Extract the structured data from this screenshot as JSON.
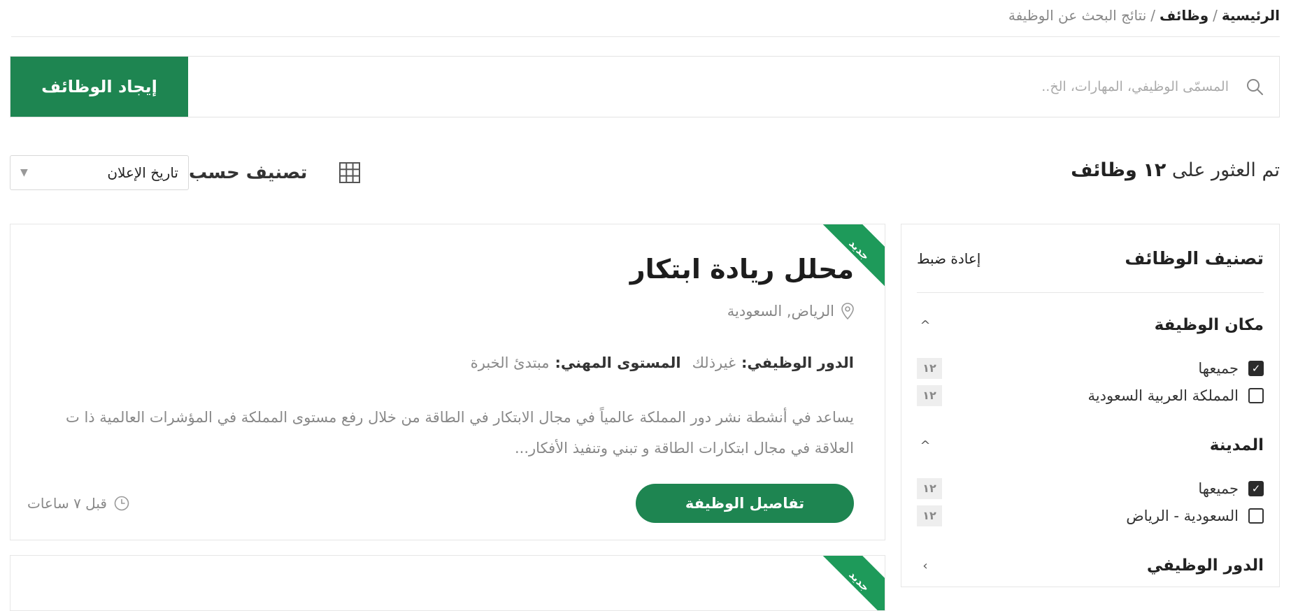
{
  "breadcrumb": {
    "home": "الرئيسية",
    "jobs": "وظائف",
    "current": "نتائج البحث عن الوظيفة",
    "separator": "/"
  },
  "search": {
    "placeholder": "المسمّى الوظيفي، المهارات، الخ..",
    "value": "",
    "button_label": "إيجاد الوظائف"
  },
  "results": {
    "prefix": "تم العثور على",
    "count": "١٢",
    "suffix": "وظائف"
  },
  "sort": {
    "label": "تصنيف حسب",
    "selected": "تاريخ الإعلان"
  },
  "filters": {
    "title": "تصنيف الوظائف",
    "reset_label": "إعادة ضبط",
    "groups": [
      {
        "title": "مكان الوظيفة",
        "options": [
          {
            "label": "جميعها",
            "count": "١٢",
            "checked": true
          },
          {
            "label": "المملكة العربية السعودية",
            "count": "١٢",
            "checked": false
          }
        ]
      },
      {
        "title": "المدينة",
        "options": [
          {
            "label": "جميعها",
            "count": "١٢",
            "checked": true
          },
          {
            "label": "السعودية - الرياض",
            "count": "١٢",
            "checked": false
          }
        ]
      },
      {
        "title": "الدور الوظيفي"
      }
    ]
  },
  "jobs": [
    {
      "badge": "جديد",
      "title": "محلل ريادة ابتكار",
      "location": "الرياض, السعودية",
      "role_key": "الدور الوظيفي:",
      "role_value": "غيرذلك",
      "level_key": "المستوى المهني:",
      "level_value": "مبتدئ الخبرة",
      "description": "يساعد في أنشطة نشر دور المملكة عالمياً في مجال الابتكار في الطاقة من خلال رفع مستوى المملكة في المؤشرات العالمية ذا ت العلاقة في مجال ابتكارات الطاقة و تبني وتنفيذ الأفكار...",
      "details_label": "تفاصيل الوظيفة",
      "posted": "قبل ٧ ساعات"
    },
    {
      "badge": "جديد"
    }
  ],
  "colors": {
    "accent": "#1e8551",
    "ribbon": "#1e9a5a"
  }
}
